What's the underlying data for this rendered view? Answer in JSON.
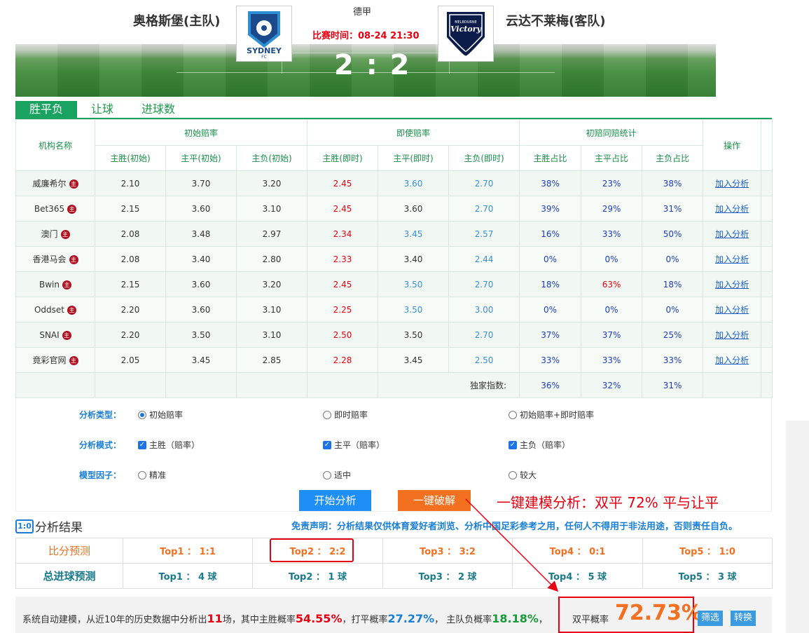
{
  "match": {
    "home_team": "奥格斯堡(主队)",
    "away_team": "云达不莱梅(客队)",
    "league": "德甲",
    "time": "比赛时间：08-24 21:30",
    "score": "2 : 2",
    "home_logo_text": "SYDNEY",
    "home_logo_sub": "FC",
    "away_logo_text": "Victory",
    "away_logo_sub": "MELBOURNE"
  },
  "tabs": [
    {
      "label": "胜平负",
      "active": true
    },
    {
      "label": "让球",
      "active": false
    },
    {
      "label": "进球数",
      "active": false
    }
  ],
  "odds_table": {
    "headers": {
      "agency": "机构名称",
      "group_initial": "初始赔率",
      "group_live": "即使赔率",
      "group_stats": "初赔同赔统计",
      "action": "操作",
      "sub": [
        "主胜(初始)",
        "主平(初始)",
        "主负(初始)",
        "主胜(即时)",
        "主平(即时)",
        "主负(即时)",
        "主胜占比",
        "主平占比",
        "主负占比"
      ]
    },
    "flag_char": "主",
    "action_label": "加入分析",
    "rows": [
      {
        "agency": "威廉希尔",
        "init": [
          "2.10",
          "3.70",
          "3.20"
        ],
        "live": [
          "2.45",
          "3.60",
          "2.70"
        ],
        "pct": [
          "38%",
          "23%",
          "38%"
        ]
      },
      {
        "agency": "Bet365",
        "init": [
          "2.15",
          "3.60",
          "3.10"
        ],
        "live": [
          "2.45",
          "3.60",
          "2.70"
        ],
        "pct": [
          "39%",
          "29%",
          "31%"
        ]
      },
      {
        "agency": "澳门",
        "init": [
          "2.08",
          "3.48",
          "2.97"
        ],
        "live": [
          "2.34",
          "3.45",
          "2.57"
        ],
        "pct": [
          "16%",
          "33%",
          "50%"
        ]
      },
      {
        "agency": "香港马会",
        "init": [
          "2.08",
          "3.40",
          "2.80"
        ],
        "live": [
          "2.33",
          "3.40",
          "2.44"
        ],
        "pct": [
          "0%",
          "0%",
          "0%"
        ]
      },
      {
        "agency": "Bwin",
        "init": [
          "2.15",
          "3.60",
          "3.20"
        ],
        "live": [
          "2.45",
          "3.50",
          "2.70"
        ],
        "pct": [
          "18%",
          "63%",
          "18%"
        ]
      },
      {
        "agency": "Oddset",
        "init": [
          "2.20",
          "3.60",
          "3.10"
        ],
        "live": [
          "2.25",
          "3.50",
          "3.00"
        ],
        "pct": [
          "0%",
          "0%",
          "0%"
        ]
      },
      {
        "agency": "SNAI",
        "init": [
          "2.20",
          "3.50",
          "3.10"
        ],
        "live": [
          "2.50",
          "3.50",
          "2.70"
        ],
        "pct": [
          "37%",
          "37%",
          "25%"
        ]
      },
      {
        "agency": "竟彩官网",
        "init": [
          "2.05",
          "3.45",
          "2.85"
        ],
        "live": [
          "2.28",
          "3.45",
          "2.50"
        ],
        "pct": [
          "33%",
          "33%",
          "33%"
        ]
      }
    ],
    "exclusive_label": "独家指数:",
    "exclusive": [
      "36%",
      "32%",
      "31%"
    ]
  },
  "analysis": {
    "type_label": "分析类型：",
    "type_options": [
      "初始赔率",
      "即时赔率",
      "初始赔率+即时赔率"
    ],
    "mode_label": "分析模式：",
    "mode_options": [
      "主胜（赔率）",
      "主平（赔率）",
      "主负（赔率）"
    ],
    "factor_label": "模型因子：",
    "factor_options": [
      "精准",
      "适中",
      "较大"
    ],
    "start_button": "开始分析",
    "crack_button": "一键破解",
    "promo": "一键建模分析：双平 72%  平与让平"
  },
  "results": {
    "icon_text": "1:0",
    "title": "分析结果",
    "disclaimer": "免责声明：分析结果仅供体育爱好者浏览、分析中国足彩参考之用，任何人不得用于非法用途，否则责任自负。",
    "score_label": "比分预测",
    "score_preds": [
      "Top1 ： 1:1",
      "Top2 ： 2:2",
      "Top3 ： 3:2",
      "Top4 ： 0:1",
      "Top5 ： 1:0"
    ],
    "goals_label": "总进球预测",
    "goals_preds": [
      "Top1 ： 4 球",
      "Top2 ： 1 球",
      "Top3 ： 2 球",
      "Top4 ： 5 球",
      "Top5 ： 3 球"
    ]
  },
  "system": {
    "pre": "系统自动建模，从近10年的历史数据中分析出",
    "matches": "11",
    "mid1": "场，其中主胜概率",
    "home_rate": "54.55%",
    "mid2": "，打平概率",
    "draw_rate": "27.27%",
    "mid3": "， 主队负概率",
    "away_rate": "18.18%",
    "mid4": "，",
    "double_draw_label": "双平概率",
    "double_draw_rate": "72.73%",
    "filter_button": "筛选",
    "convert_button": "转换"
  },
  "colors": {
    "accent_green": "#1aa260",
    "red": "#e60012",
    "orange": "#f37021",
    "blue": "#1a7fd4"
  }
}
